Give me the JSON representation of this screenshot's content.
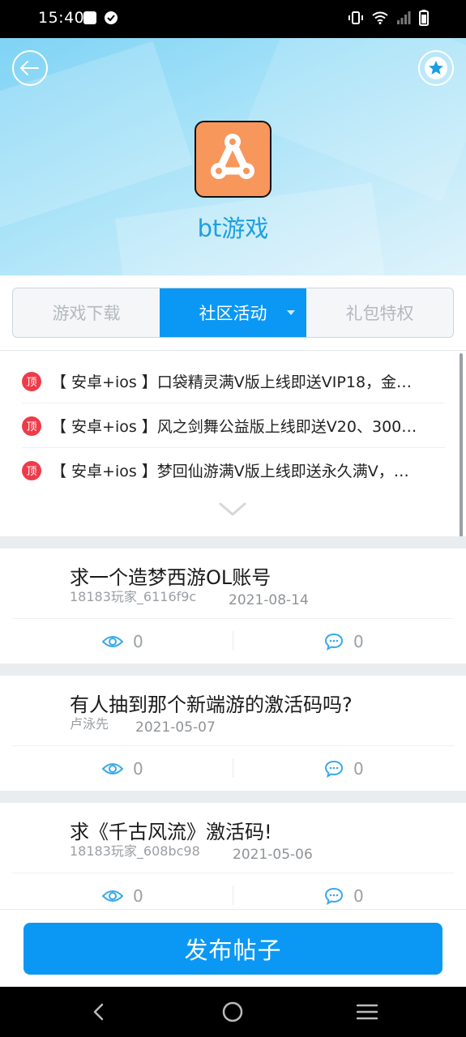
{
  "status_bar": {
    "time": "15:40"
  },
  "app": {
    "title": "bt游戏",
    "accent": "#0b98f5",
    "icon_color": "#f7975c"
  },
  "tabs": [
    {
      "label": "游戏下载",
      "active": false
    },
    {
      "label": "社区活动",
      "active": true
    },
    {
      "label": "礼包特权",
      "active": false
    }
  ],
  "pinned": {
    "badge": "顶",
    "items": [
      "【 安卓+ios 】口袋精灵满V版上线即送VIP18，金…",
      "【 安卓+ios 】风之剑舞公益版上线即送V20、300…",
      "【 安卓+ios 】梦回仙游满V版上线即送永久满V，…"
    ]
  },
  "posts": [
    {
      "title": "求一个造梦西游OL账号",
      "author": "18183玩家_6116f9c",
      "date": "2021-08-14",
      "views": "0",
      "comments": "0"
    },
    {
      "title": "有人抽到那个新端游的激活码吗?",
      "author": "卢泳先",
      "date": "2021-05-07",
      "views": "0",
      "comments": "0"
    },
    {
      "title": "求《千古风流》激活码!",
      "author": "18183玩家_608bc98",
      "date": "2021-05-06",
      "views": "0",
      "comments": "0"
    }
  ],
  "publish_button": "发布帖子"
}
